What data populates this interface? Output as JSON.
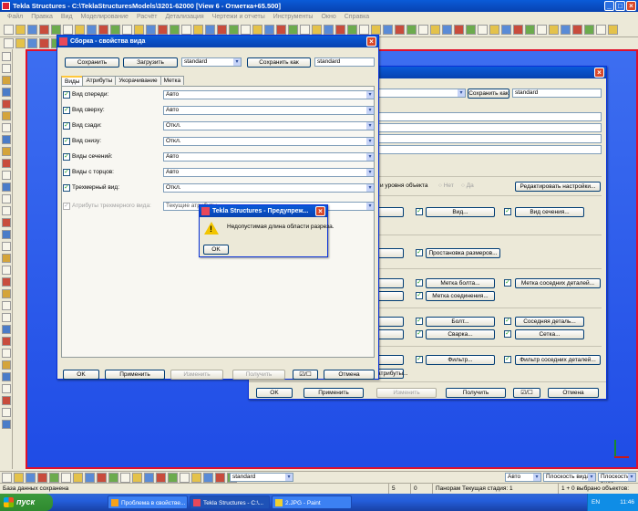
{
  "app": {
    "title": "Tekla Structures - C:\\TeklaStructuresModels\\3201-62000   [View 6 - Отметка+65.500]",
    "menu": [
      "Файл",
      "Правка",
      "Вид",
      "Моделирование",
      "Расчёт",
      "Детализация",
      "Чертежи и отчеты",
      "Инструменты",
      "Окно",
      "Справка"
    ]
  },
  "back_dialog": {
    "save_as_label": "Сохранить как",
    "save_as_value": "standard",
    "redact_settings": "Редактировать настройки...",
    "object_level_label": "и уровня объекта",
    "radio_no": "Нет",
    "radio_yes": "Да",
    "rows": [
      {
        "a": "",
        "b": "Вид...",
        "c": "Вид сечения..."
      },
      {
        "a": "",
        "b": "Простановка размеров..."
      },
      {
        "a": "",
        "b": "Метка болта...",
        "c": "Метка соседних деталей..."
      },
      {
        "a": "",
        "b": "Метка соединения..."
      },
      {
        "a": "",
        "b": "Болт...",
        "c": "Соседняя деталь..."
      },
      {
        "a": "",
        "b": "Сварка...",
        "c": "Сетка..."
      },
      {
        "a": "",
        "b": "Фильтр...",
        "c": "Фильтр соседних деталей..."
      }
    ],
    "attrs_btn": "атрибуты...",
    "footer": {
      "ok": "OK",
      "apply": "Применить",
      "modify": "Изменить",
      "get": "Получить",
      "cancel": "Отмена"
    }
  },
  "front_dialog": {
    "title": "Сборка - свойства вида",
    "save": "Сохранить",
    "load": "Загрузить",
    "load_value": "standard",
    "save_as": "Сохранить как",
    "save_as_value": "standard",
    "tabs": [
      "Виды",
      "Атрибуты",
      "Укорачивание",
      "Метка"
    ],
    "rows": [
      {
        "label": "Вид спереди:",
        "value": "Авто"
      },
      {
        "label": "Вид сверху:",
        "value": "Авто"
      },
      {
        "label": "Вид сзади:",
        "value": "Откл."
      },
      {
        "label": "Вид снизу:",
        "value": "Откл."
      },
      {
        "label": "Виды сечений:",
        "value": "Авто"
      },
      {
        "label": "Виды с торцов:",
        "value": "Авто"
      },
      {
        "label": "Трехмерный вид:",
        "value": "Откл."
      }
    ],
    "attr3d_label": "Атрибуты трехмерного вида:",
    "attr3d_value": "Текущие атрибуты",
    "footer": {
      "ok": "OK",
      "apply": "Применить",
      "modify": "Изменить",
      "get": "Получить",
      "cancel": "Отмена"
    }
  },
  "warning": {
    "title": "Tekla Structures - Предупреж...",
    "message": "Недопустимая длина области разреза.",
    "ok": "OK"
  },
  "bottombar": {
    "combo1": "standard",
    "combo2": "Авто",
    "combo3": "Плоскость вида",
    "combo4": "Плоскость вида"
  },
  "statusbar": {
    "left": "База данных сохранена",
    "num1": "5",
    "num2": "0",
    "mode": "Панорам Текущая стадия: 1",
    "selected": "1 + 0 выбрано объектов:"
  },
  "taskbar": {
    "start": "пуск",
    "tasks": [
      "Проблема в свойстве...",
      "Tekla Structures - C:\\...",
      "2.JPG - Paint"
    ],
    "lang": "EN",
    "time": "11:46"
  }
}
